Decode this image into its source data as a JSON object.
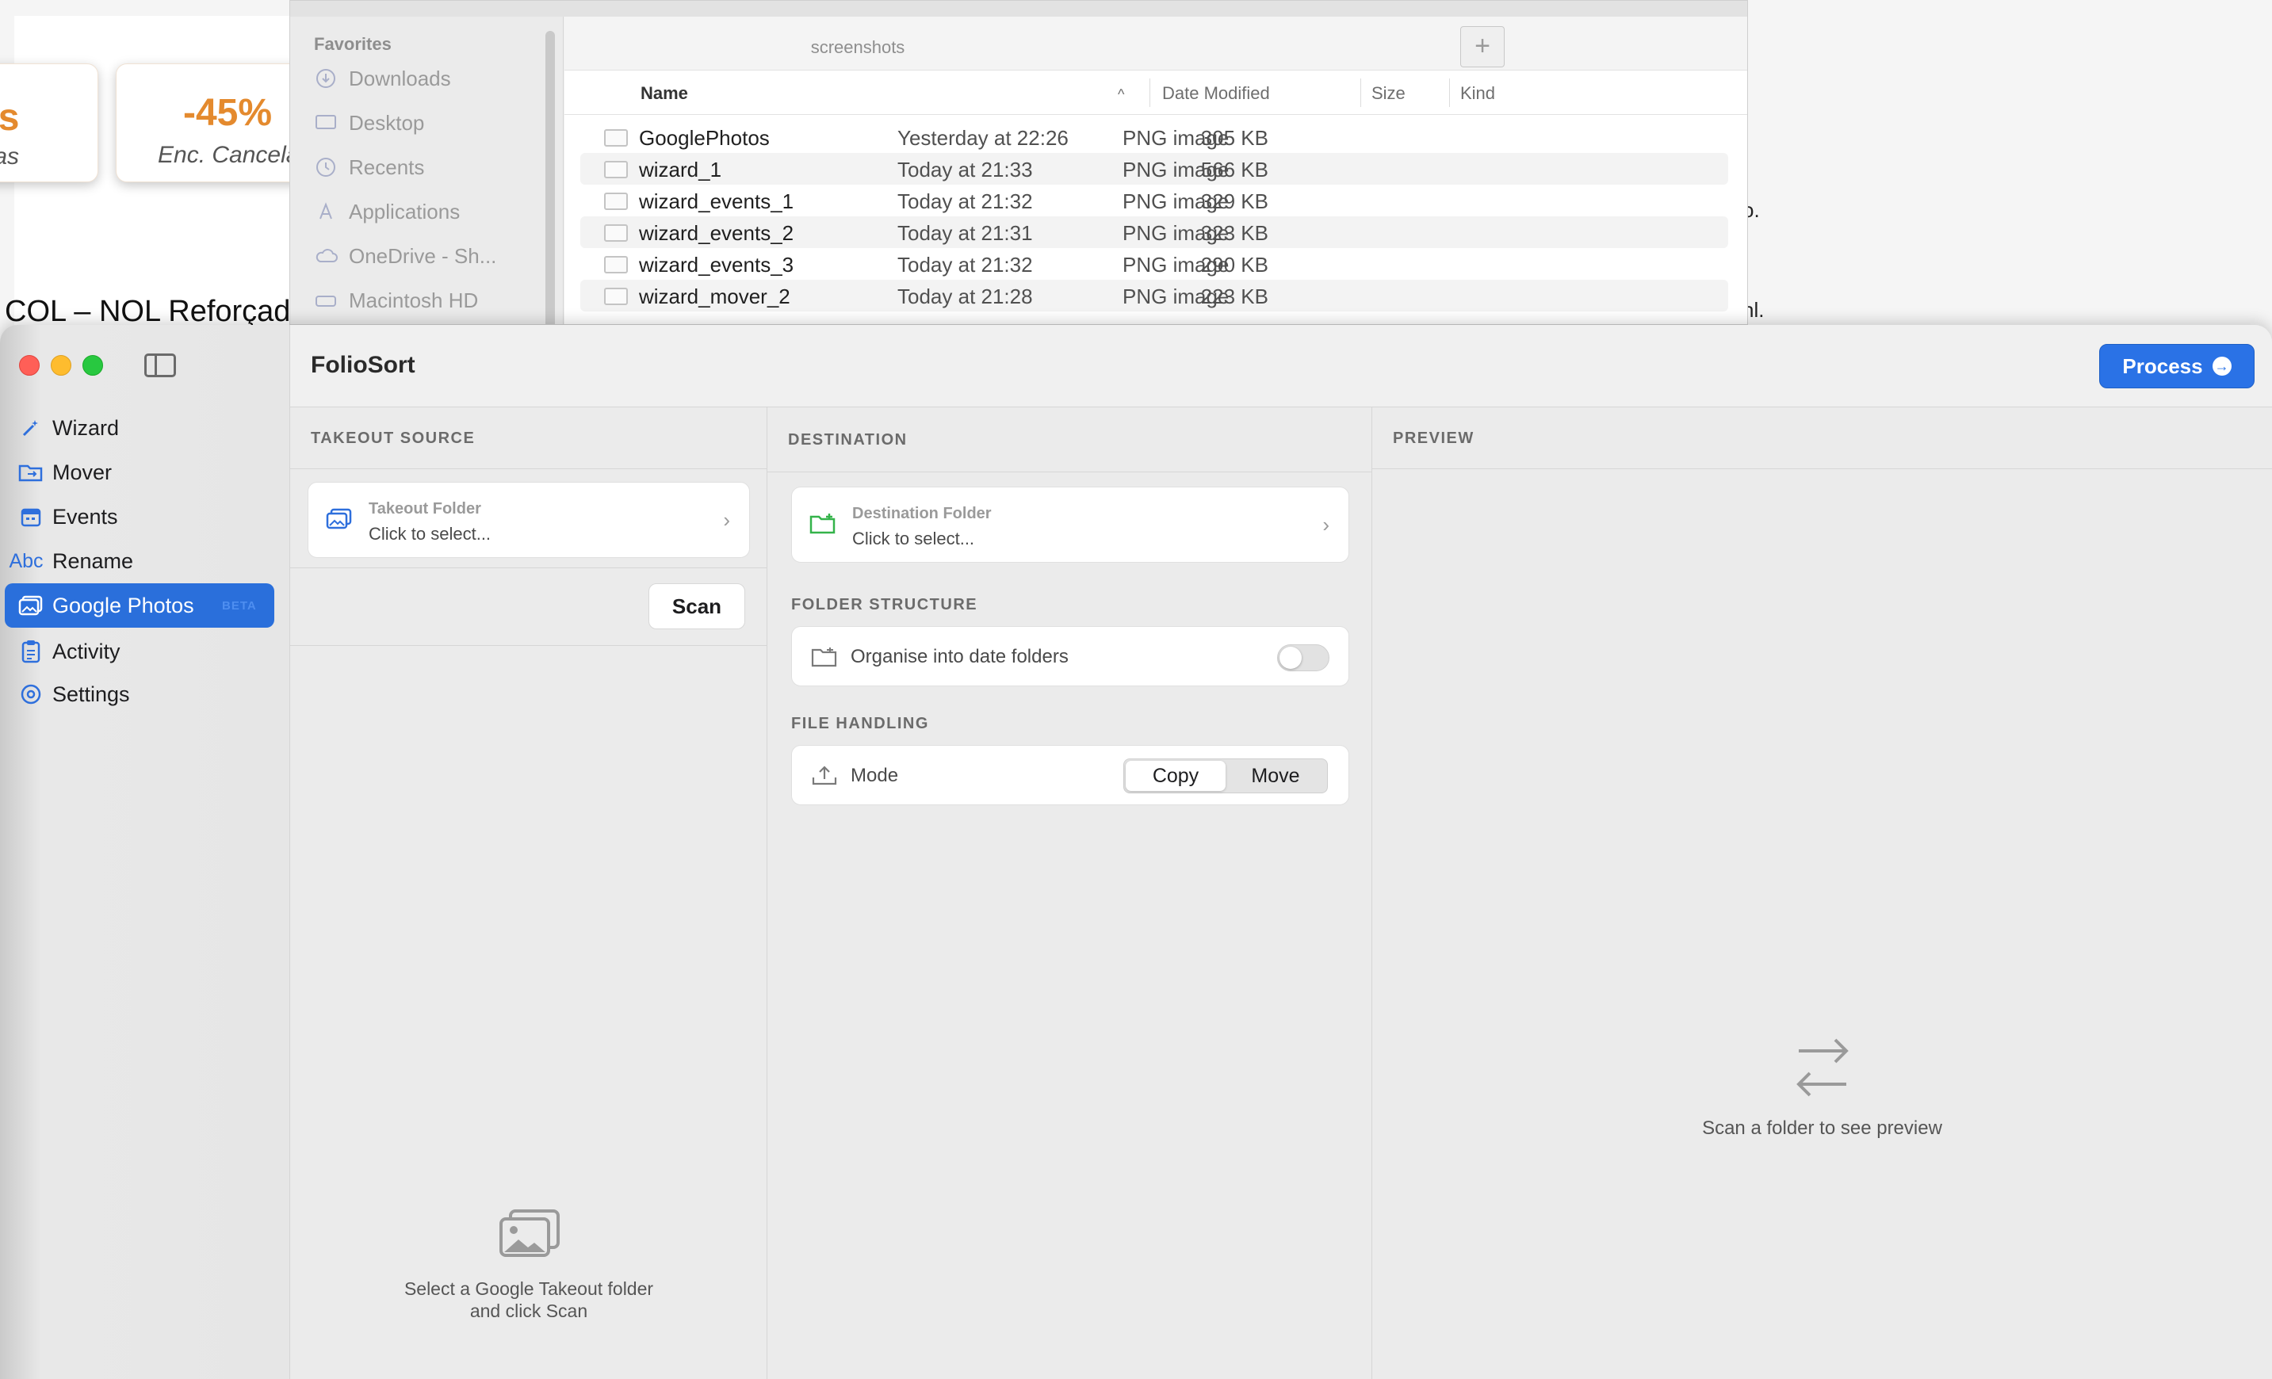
{
  "background_doc": {
    "kpi_left_value": "ês",
    "kpi_left_label": "adas",
    "kpi_mid_value": "-45%",
    "kpi_mid_label": "Enc. Cancela",
    "heading": "COL – NOL Reforçad",
    "frag_1": "o.",
    "frag_2": "nl.",
    "accent": "#e48a2e"
  },
  "finder": {
    "sidebar": {
      "header": "Favorites",
      "items": [
        {
          "label": "Downloads",
          "icon": "download-icon"
        },
        {
          "label": "Desktop",
          "icon": "desktop-icon"
        },
        {
          "label": "Recents",
          "icon": "clock-icon"
        },
        {
          "label": "Applications",
          "icon": "applications-icon"
        },
        {
          "label": "OneDrive - Sh...",
          "icon": "cloud-icon"
        },
        {
          "label": "Macintosh HD",
          "icon": "disk-icon"
        }
      ]
    },
    "path_title": "screenshots",
    "plus_label": "+",
    "columns": {
      "name": "Name",
      "sort_indicator": "^",
      "date": "Date Modified",
      "size": "Size",
      "kind": "Kind"
    },
    "rows": [
      {
        "name": "GooglePhotos",
        "date": "Yesterday at 22:26",
        "size": "305 KB",
        "kind": "PNG image"
      },
      {
        "name": "wizard_1",
        "date": "Today at 21:33",
        "size": "566 KB",
        "kind": "PNG image"
      },
      {
        "name": "wizard_events_1",
        "date": "Today at 21:32",
        "size": "329 KB",
        "kind": "PNG image"
      },
      {
        "name": "wizard_events_2",
        "date": "Today at 21:31",
        "size": "323 KB",
        "kind": "PNG image"
      },
      {
        "name": "wizard_events_3",
        "date": "Today at 21:32",
        "size": "290 KB",
        "kind": "PNG image"
      },
      {
        "name": "wizard_mover_2",
        "date": "Today at 21:28",
        "size": "223 KB",
        "kind": "PNG image"
      }
    ]
  },
  "app": {
    "title": "FolioSort",
    "process_label": "Process",
    "accent": "#2a72e6",
    "nav": [
      {
        "label": "Wizard",
        "icon": "wand-icon",
        "selected": false
      },
      {
        "label": "Mover",
        "icon": "folder-move-icon",
        "selected": false
      },
      {
        "label": "Events",
        "icon": "calendar-icon",
        "selected": false
      },
      {
        "label": "Rename",
        "icon": "abc-icon",
        "icon_text": "Abc",
        "selected": false
      },
      {
        "label": "Google Photos",
        "icon": "photos-icon",
        "selected": true,
        "badge": "BETA"
      },
      {
        "label": "Activity",
        "icon": "clipboard-icon",
        "selected": false
      },
      {
        "label": "Settings",
        "icon": "gear-icon",
        "selected": false
      }
    ],
    "source": {
      "header": "TAKEOUT SOURCE",
      "folder_title": "Takeout Folder",
      "folder_sub": "Click to select...",
      "scan_label": "Scan",
      "empty_line1": "Select a Google Takeout folder",
      "empty_line2": "and click Scan"
    },
    "destination": {
      "header": "DESTINATION",
      "folder_title": "Destination Folder",
      "folder_sub": "Click to select...",
      "structure_header": "FOLDER STRUCTURE",
      "organise_label": "Organise into date folders",
      "organise_enabled": false,
      "handling_header": "FILE HANDLING",
      "mode_label": "Mode",
      "mode_options": [
        "Copy",
        "Move"
      ],
      "mode_selected": "Copy"
    },
    "preview": {
      "header": "PREVIEW",
      "empty_text": "Scan a folder to see preview"
    }
  }
}
